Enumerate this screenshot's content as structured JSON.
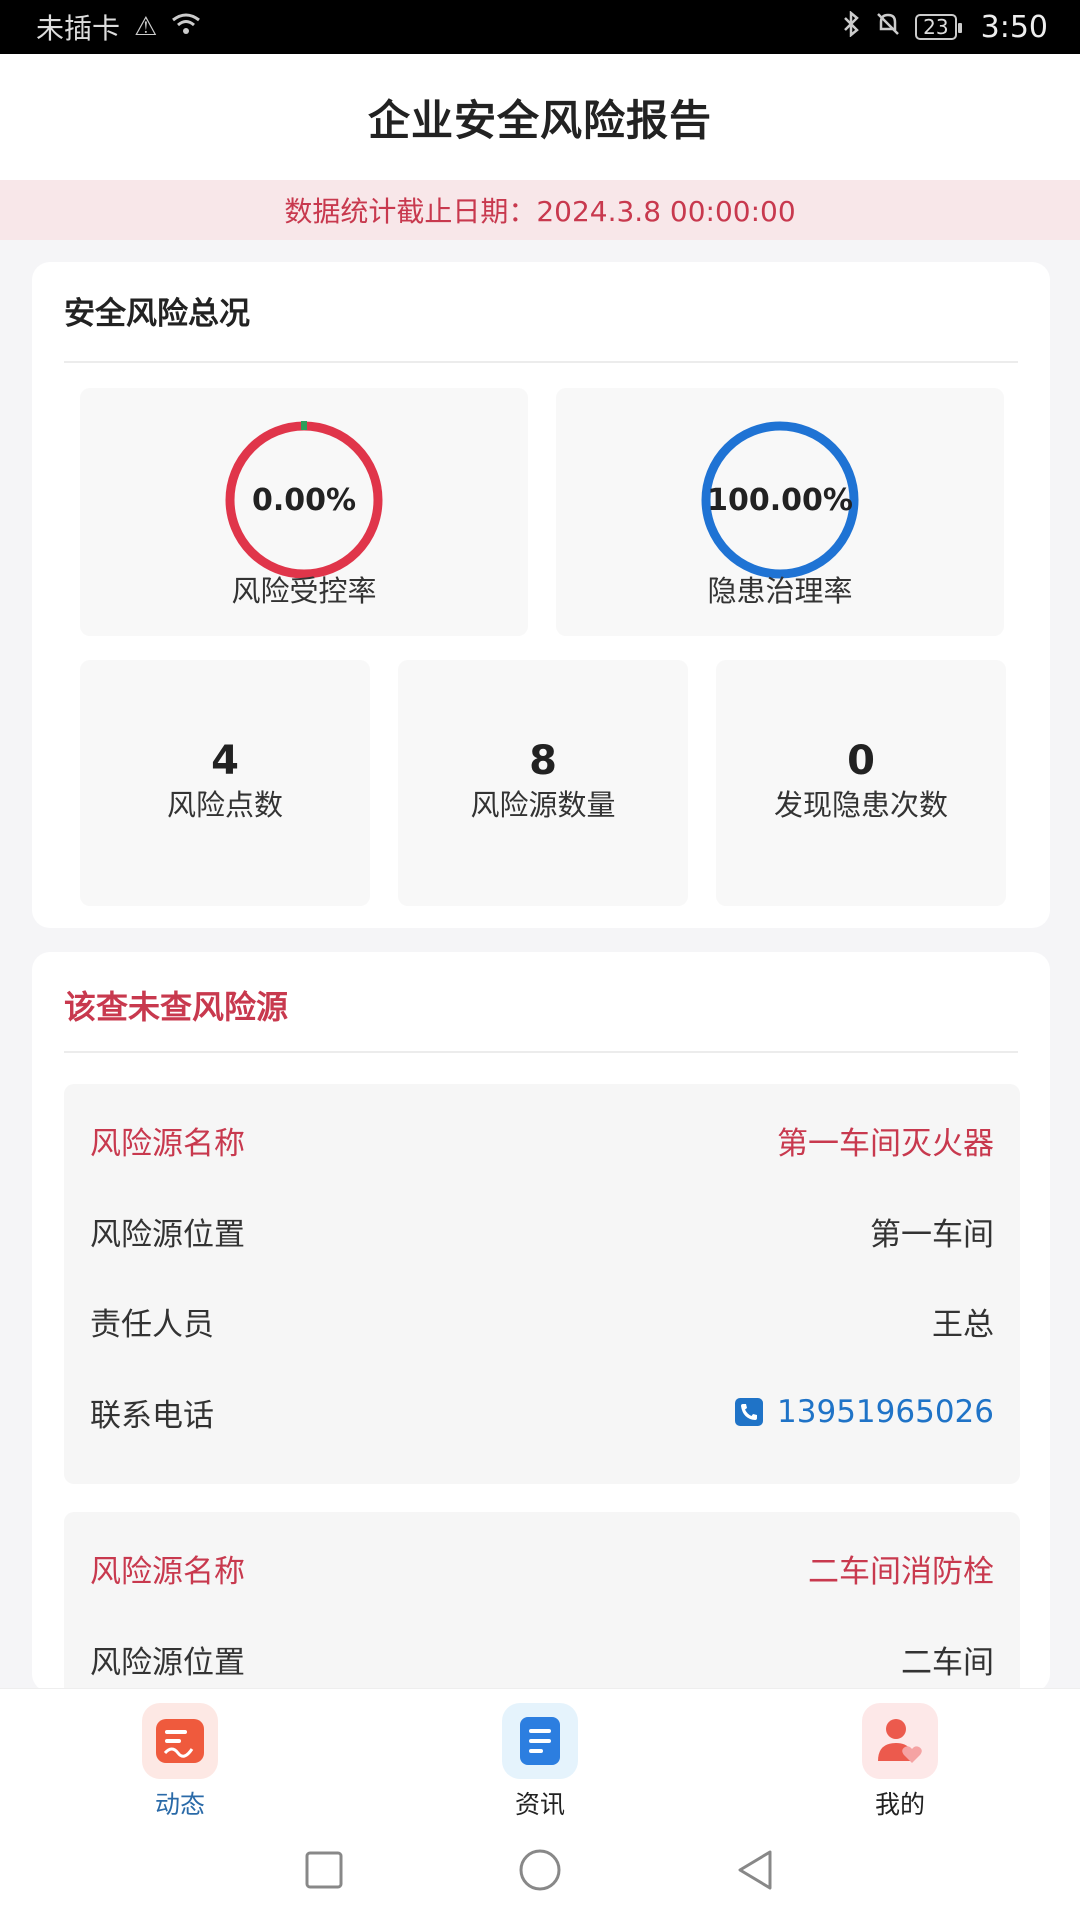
{
  "status_bar": {
    "carrier": "未插卡",
    "battery": "23",
    "time": "3:50"
  },
  "header": {
    "title": "企业安全风险报告"
  },
  "date_bar": {
    "text": "数据统计截止日期：2024.3.8 00:00:00"
  },
  "overview": {
    "title": "安全风险总况",
    "rates": [
      {
        "value": "0.00%",
        "label": "风险受控率",
        "ring_color": "#e0354a",
        "fraction": 0.0
      },
      {
        "value": "100.00%",
        "label": "隐患治理率",
        "ring_color": "#1f73d4",
        "fraction": 1.0
      }
    ],
    "stats": [
      {
        "value": "4",
        "label": "风险点数"
      },
      {
        "value": "8",
        "label": "风险源数量"
      },
      {
        "value": "0",
        "label": "发现隐患次数"
      }
    ]
  },
  "unchecked": {
    "title": "该查未查风险源",
    "records": [
      {
        "name_label": "风险源名称",
        "name": "第一车间灭火器",
        "location_label": "风险源位置",
        "location": "第一车间",
        "person_label": "责任人员",
        "person": "王总",
        "phone_label": "联系电话",
        "phone": "13951965026"
      },
      {
        "name_label": "风险源名称",
        "name": "二车间消防栓",
        "location_label": "风险源位置",
        "location": "二车间"
      }
    ]
  },
  "bottom_nav": {
    "items": [
      {
        "label": "动态",
        "icon": "dynamic-icon",
        "active": true
      },
      {
        "label": "资讯",
        "icon": "news-icon",
        "active": false
      },
      {
        "label": "我的",
        "icon": "profile-icon",
        "active": false
      }
    ]
  },
  "colors": {
    "accent_red": "#c8394e",
    "link_blue": "#1f73c7"
  }
}
